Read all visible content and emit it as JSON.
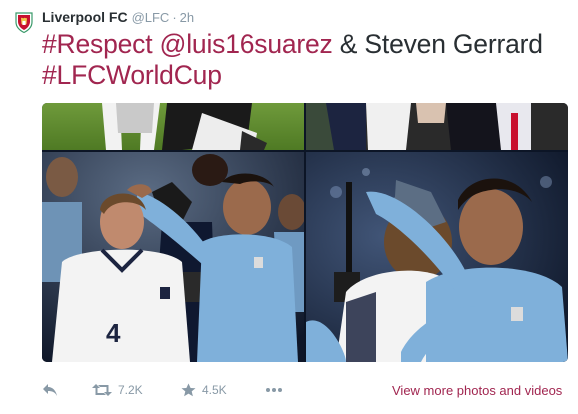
{
  "tweet": {
    "author_name": "Liverpool FC",
    "author_handle": "@LFC",
    "separator": "·",
    "timestamp": "2h",
    "text_hashtag1": "#Respect",
    "text_mention": "@luis16suarez",
    "text_plain": " & Steven Gerrard",
    "text_hashtag2": "#LFCWorldCup"
  },
  "media": {
    "shirt_number": "4"
  },
  "actions": {
    "retweet_count": "7.2K",
    "favorite_count": "4.5K",
    "view_more": "View more photos and videos"
  },
  "colors": {
    "link": "#a12650",
    "meta": "#8899a6",
    "text": "#292f33",
    "uruguay_blue": "#7fb0da",
    "stadium_dark": "#0c1526"
  },
  "icons": [
    "lfc-crest-icon",
    "reply-icon",
    "retweet-icon",
    "favorite-icon",
    "more-icon"
  ]
}
